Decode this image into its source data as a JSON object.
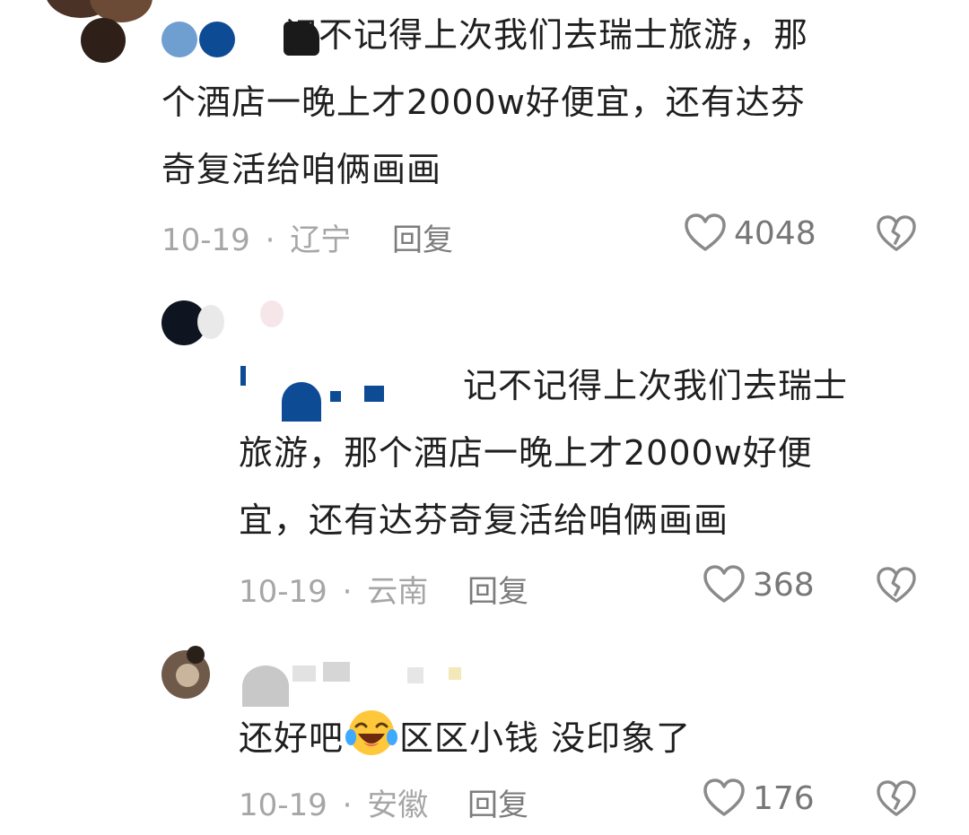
{
  "comments": [
    {
      "name_visible": "",
      "text_line1": "记不记得上次我们去瑞士旅游，那",
      "text_line2": "个酒店一晚上才2000w好便宜，还有达芬",
      "text_line3": "奇复活给咱俩画画",
      "date": "10-19",
      "location": "辽宁",
      "reply_label": "回复",
      "likes": "4048"
    },
    {
      "quote_line1": "记不记得上次我们去瑞士",
      "quote_line2": "旅游，那个酒店一晚上才2000w好便",
      "quote_line3": "宜，还有达芬奇复活给咱俩画画",
      "date": "10-19",
      "location": "云南",
      "reply_label": "回复",
      "likes": "368"
    },
    {
      "text_before_emoji": "还好吧",
      "emoji_name": "laughing-crying-emoji",
      "text_after_emoji": "区区小钱 没印象了",
      "date": "10-19",
      "location": "安徽",
      "reply_label": "回复",
      "likes": "176"
    }
  ],
  "separator": "·",
  "icons": {
    "like": "heart-outline-icon",
    "dislike": "broken-heart-icon"
  },
  "colors": {
    "text": "#1f1f1f",
    "meta": "#a6a6a6",
    "reply": "#7c7c7c",
    "icon": "#8a8a8a"
  }
}
